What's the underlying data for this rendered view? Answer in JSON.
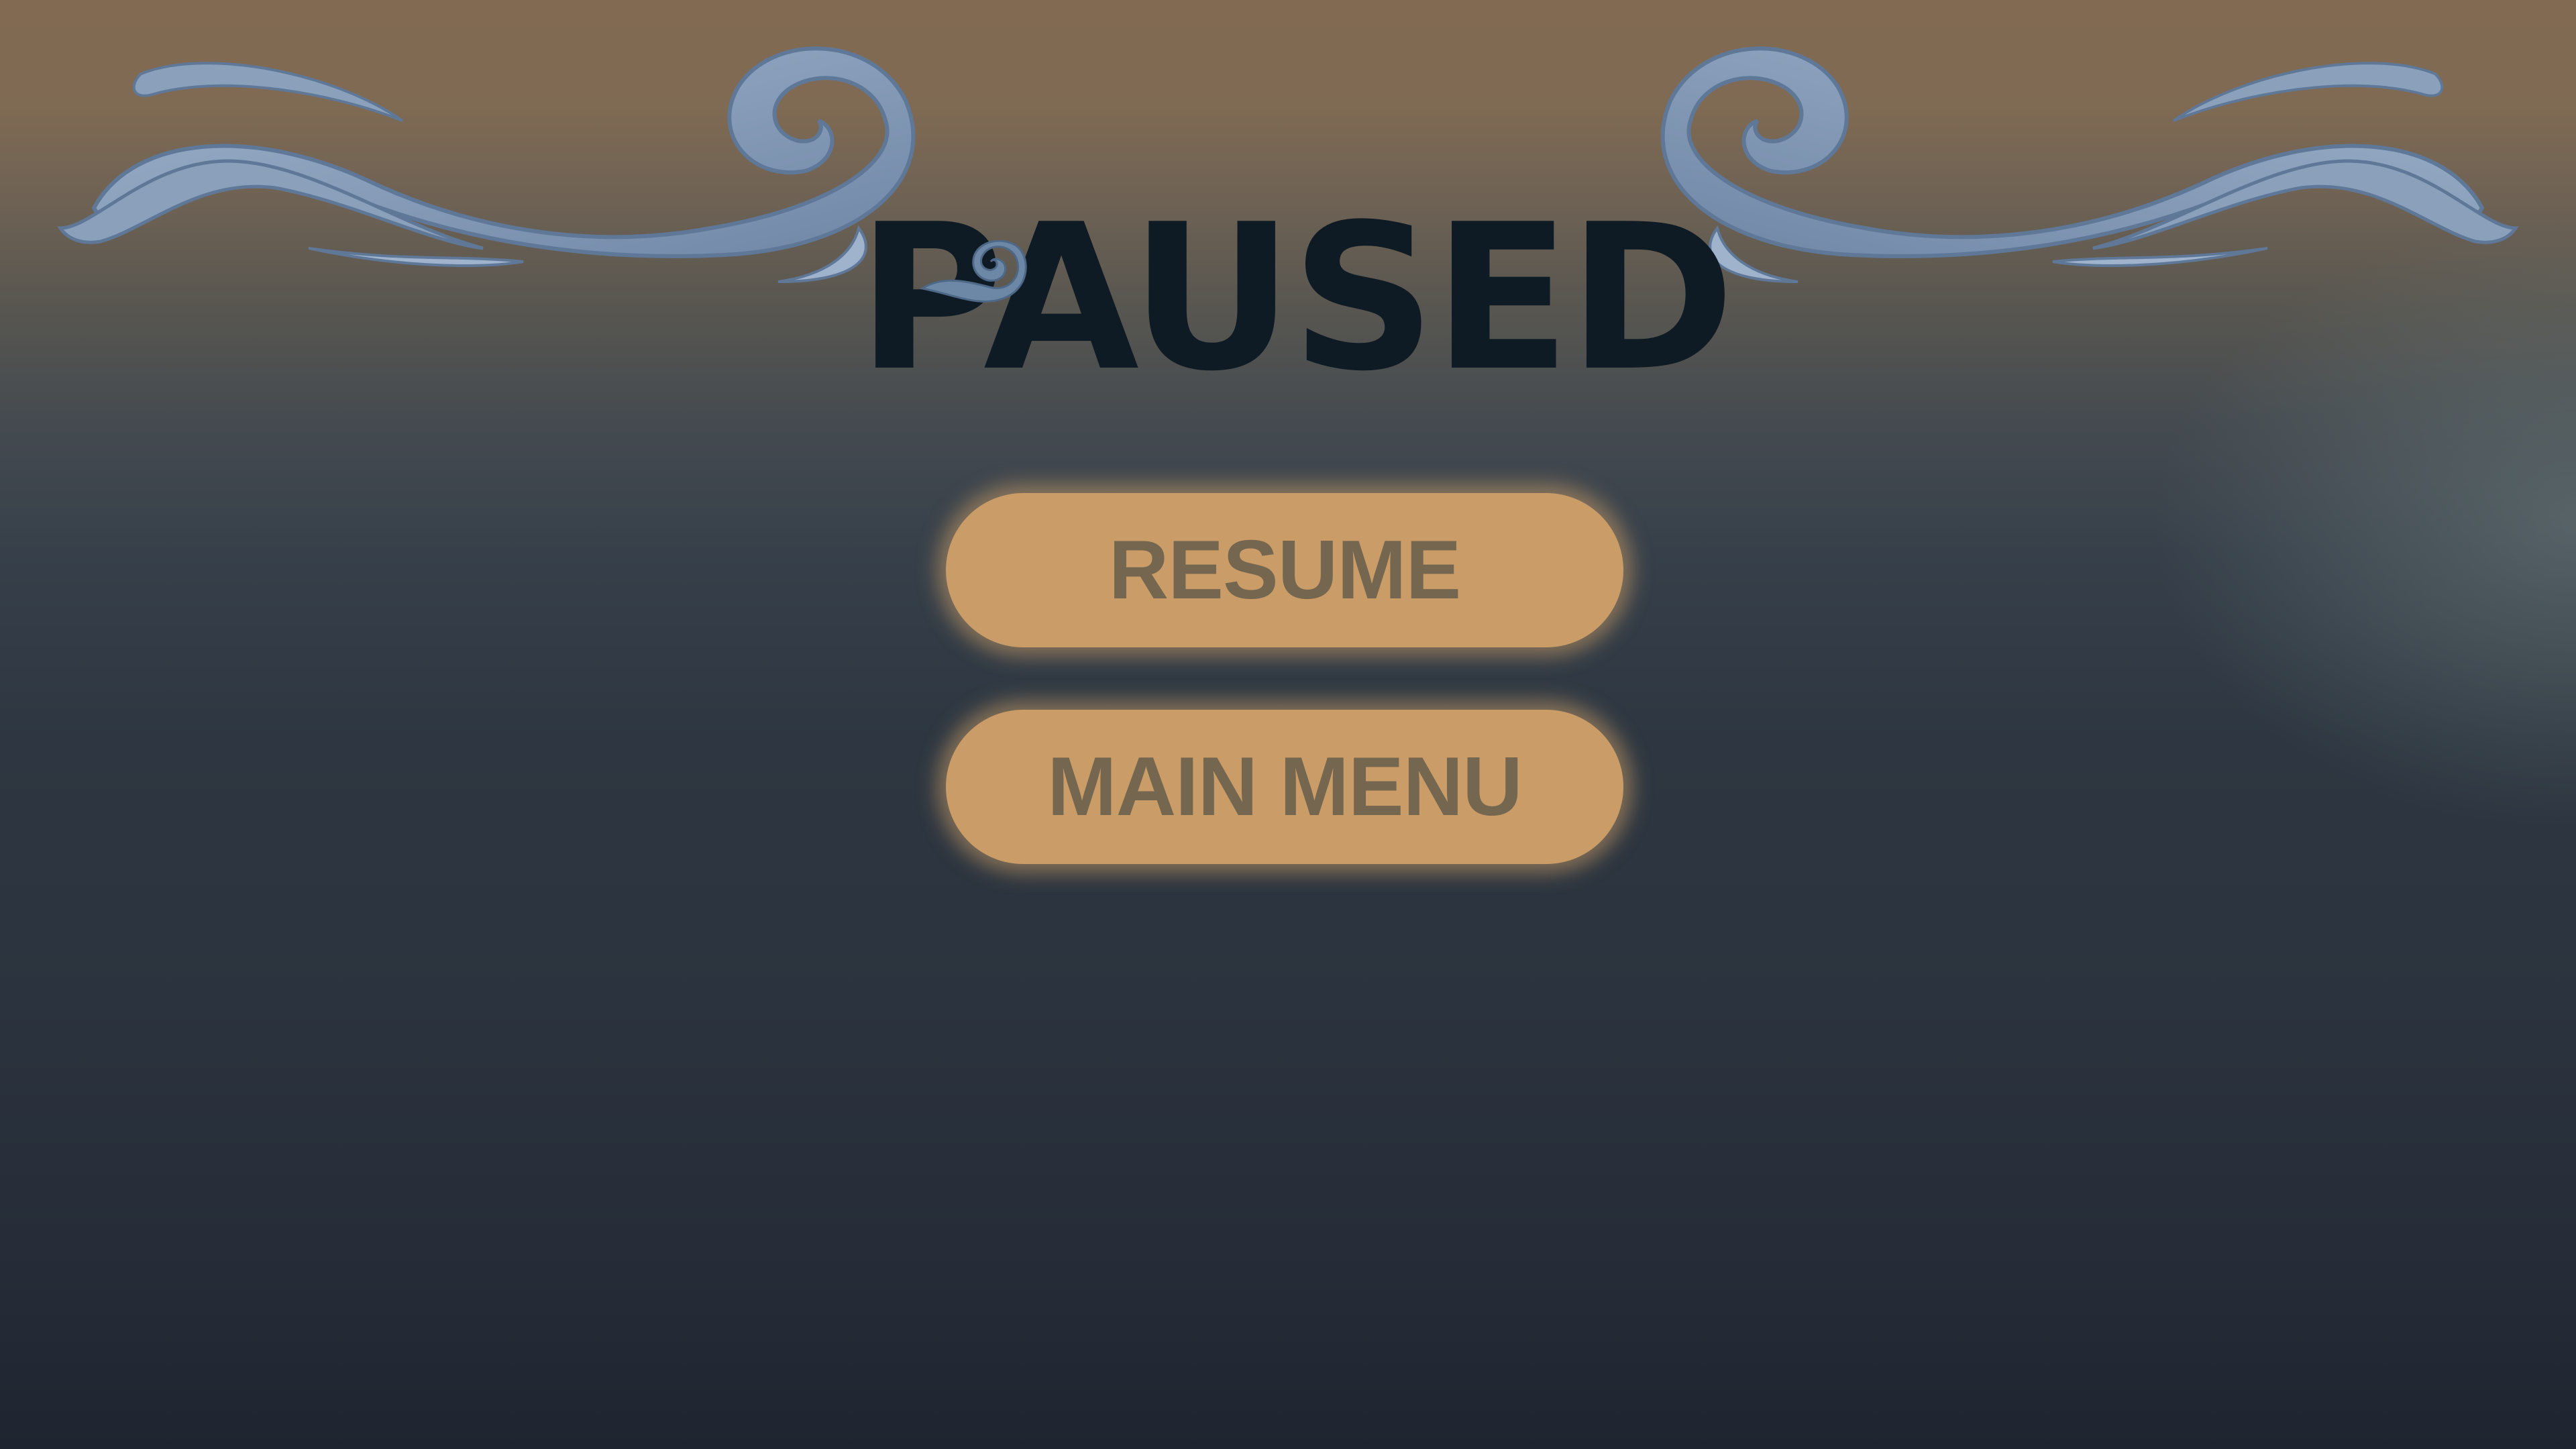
{
  "pause_menu": {
    "title": "PAUSED",
    "buttons": {
      "resume": "RESUME",
      "main_menu": "MAIN MENU"
    }
  },
  "icons": {
    "left_ornament": "wave-flourish-icon",
    "right_ornament": "wave-flourish-icon",
    "title_swirl": "swirl-icon"
  },
  "colors": {
    "button_fill": "#c99c68",
    "button_text": "#756650",
    "title_text": "#0f1b24",
    "ornament": "#8aa0bb"
  }
}
